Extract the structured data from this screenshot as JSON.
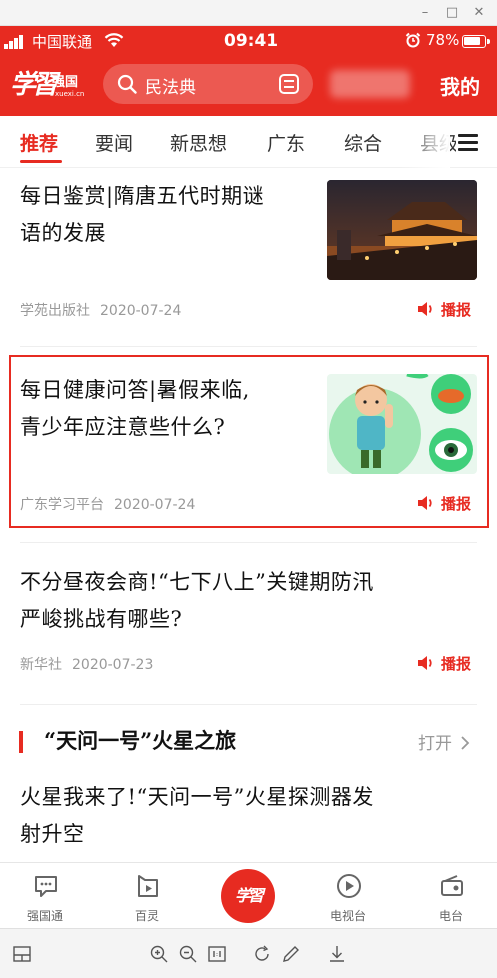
{
  "window": {
    "minimize": "–",
    "maximize": "□",
    "close": "✕"
  },
  "status_bar": {
    "carrier": "中国联通",
    "time": "09:41",
    "battery": "78%"
  },
  "header": {
    "logo_main": "学習",
    "logo_sub": "强国",
    "logo_domain": "xuexi.cn",
    "search_text": "民法典",
    "mine_label": "我的"
  },
  "tabs": [
    "推荐",
    "要闻",
    "新思想",
    "广东",
    "综合",
    "县级"
  ],
  "active_tab": "推荐",
  "articles": [
    {
      "title_line1": "每日鉴赏|隋唐五代时期谜",
      "title_line2": "语的发展",
      "source": "学苑出版社",
      "date": "2020-07-24",
      "play_label": "播报",
      "thumb": "night-temple-illustration"
    },
    {
      "title_line1": "每日健康问答|暑假来临,",
      "title_line2": "青少年应注意些什么?",
      "source": "广东学习平台",
      "date": "2020-07-24",
      "play_label": "播报",
      "thumb": "boy-health-illustration"
    },
    {
      "title_line1": "不分昼夜会商!“七下八上”关键期防汛",
      "title_line2": "严峻挑战有哪些?",
      "source": "新华社",
      "date": "2020-07-23",
      "play_label": "播报"
    }
  ],
  "section": {
    "title": "“天问一号”火星之旅",
    "open_label": "打开",
    "article_line1": "火星我来了!“天问一号”火星探测器发",
    "article_line2": "射升空"
  },
  "bottom_nav": [
    {
      "label": "强国通",
      "icon": "chat-icon"
    },
    {
      "label": "百灵",
      "icon": "bailing-icon"
    },
    {
      "label": "学習",
      "icon": "xuexi-center-icon"
    },
    {
      "label": "电视台",
      "icon": "play-circle-icon"
    },
    {
      "label": "电台",
      "icon": "radio-icon"
    }
  ],
  "colors": {
    "brand": "#e72b21",
    "text": "#111111",
    "meta": "#999999"
  }
}
